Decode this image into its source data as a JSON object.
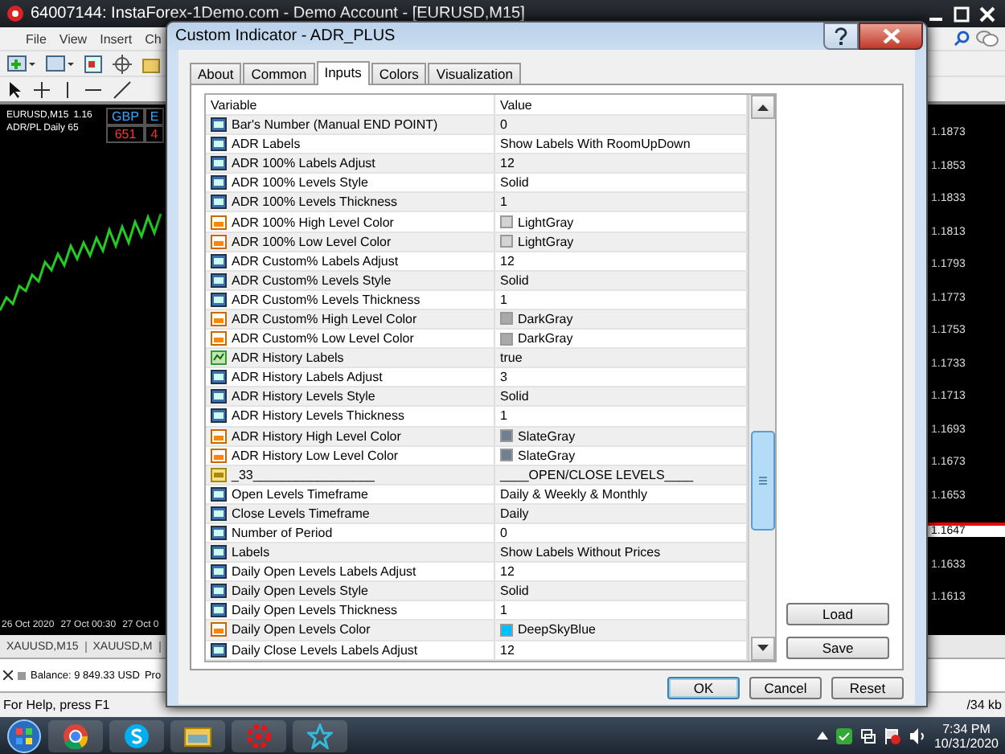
{
  "app": {
    "title": "64007144: InstaForex-1Demo.com - Demo Account - [EURUSD,M15]",
    "menu": [
      "File",
      "View",
      "Insert",
      "Ch"
    ]
  },
  "chart": {
    "symbol": "EURUSD,M15",
    "symbol_price": "1.16",
    "indicator": "ADR/PL Daily 65",
    "panel": [
      {
        "name": "GBP",
        "value": "651"
      },
      {
        "name": "E",
        "value": "4"
      }
    ],
    "price_labels": [
      {
        "label": "1.1873",
        "current": false
      },
      {
        "label": "1.1853",
        "current": false
      },
      {
        "label": "1.1833",
        "current": false
      },
      {
        "label": "1.1813",
        "current": false
      },
      {
        "label": "1.1793",
        "current": false
      },
      {
        "label": "1.1773",
        "current": false
      },
      {
        "label": "1.1753",
        "current": false
      },
      {
        "label": "1.1733",
        "current": false
      },
      {
        "label": "1.1713",
        "current": false
      },
      {
        "label": "1.1693",
        "current": false
      },
      {
        "label": "1.1673",
        "current": false
      },
      {
        "label": "1.1653",
        "current": false
      },
      {
        "label": "1.1647",
        "current": true
      },
      {
        "label": "1.1633",
        "current": false
      },
      {
        "label": "1.1613",
        "current": false
      }
    ],
    "time_labels": [
      "26 Oct 2020",
      "27 Oct 00:30",
      "27 Oct 0"
    ]
  },
  "chart_tabs": [
    {
      "label": "XAUUSD,M15",
      "selected": false
    },
    {
      "label": "XAUUSD,M",
      "selected": false
    }
  ],
  "terminal": {
    "balance": "Balance: 9 849.33 USD",
    "next": "Pro"
  },
  "status_bar": {
    "help": "For Help, press F1",
    "traffic": "/34 kb"
  },
  "dialog": {
    "title": "Custom Indicator - ADR_PLUS",
    "tabs": [
      {
        "label": "About",
        "selected": false
      },
      {
        "label": "Common",
        "selected": false
      },
      {
        "label": "Inputs",
        "selected": true
      },
      {
        "label": "Colors",
        "selected": false
      },
      {
        "label": "Visualization",
        "selected": false
      }
    ],
    "columns": [
      "Variable",
      "Value"
    ],
    "rows": [
      {
        "kind": "int",
        "variable": "Bar's Number (Manual END POINT)",
        "value": "0"
      },
      {
        "kind": "int",
        "variable": "ADR Labels",
        "value": "Show Labels With RoomUpDown"
      },
      {
        "kind": "int",
        "variable": "ADR 100% Labels Adjust",
        "value": "12"
      },
      {
        "kind": "int",
        "variable": "ADR 100% Levels Style",
        "value": "Solid"
      },
      {
        "kind": "int",
        "variable": "ADR 100% Levels Thickness",
        "value": "1"
      },
      {
        "kind": "color",
        "variable": "ADR 100% High Level Color",
        "value": "LightGray",
        "color": "#d3d3d3"
      },
      {
        "kind": "color",
        "variable": "ADR 100% Low Level Color",
        "value": "LightGray",
        "color": "#d3d3d3"
      },
      {
        "kind": "int",
        "variable": "ADR Custom% Labels Adjust",
        "value": "12"
      },
      {
        "kind": "int",
        "variable": "ADR Custom% Levels Style",
        "value": "Solid"
      },
      {
        "kind": "int",
        "variable": "ADR Custom% Levels Thickness",
        "value": "1"
      },
      {
        "kind": "color",
        "variable": "ADR Custom% High Level Color",
        "value": "DarkGray",
        "color": "#a9a9a9"
      },
      {
        "kind": "color",
        "variable": "ADR Custom% Low Level Color",
        "value": "DarkGray",
        "color": "#a9a9a9"
      },
      {
        "kind": "bool",
        "variable": "ADR History Labels",
        "value": "true"
      },
      {
        "kind": "int",
        "variable": "ADR History Labels Adjust",
        "value": "3"
      },
      {
        "kind": "int",
        "variable": "ADR History Levels Style",
        "value": "Solid"
      },
      {
        "kind": "int",
        "variable": "ADR History Levels Thickness",
        "value": "1"
      },
      {
        "kind": "color",
        "variable": "ADR History High Level Color",
        "value": "SlateGray",
        "color": "#708090"
      },
      {
        "kind": "color",
        "variable": "ADR History Low Level Color",
        "value": "SlateGray",
        "color": "#708090"
      },
      {
        "kind": "string",
        "variable": "_33_________________",
        "value": "____OPEN/CLOSE LEVELS____"
      },
      {
        "kind": "int",
        "variable": "Open Levels Timeframe",
        "value": "Daily & Weekly & Monthly"
      },
      {
        "kind": "int",
        "variable": "Close Levels Timeframe",
        "value": "Daily"
      },
      {
        "kind": "int",
        "variable": "Number of Period",
        "value": "0"
      },
      {
        "kind": "int",
        "variable": "Labels",
        "value": "Show Labels Without Prices"
      },
      {
        "kind": "int",
        "variable": "Daily Open Levels Labels Adjust",
        "value": "12"
      },
      {
        "kind": "int",
        "variable": "Daily Open Levels Style",
        "value": "Solid"
      },
      {
        "kind": "int",
        "variable": "Daily Open Levels Thickness",
        "value": "1"
      },
      {
        "kind": "color",
        "variable": "Daily Open Levels Color",
        "value": "DeepSkyBlue",
        "color": "#00bfff"
      },
      {
        "kind": "int",
        "variable": "Daily Close Levels Labels Adjust",
        "value": "12"
      }
    ],
    "side_buttons": [
      "Load",
      "Save"
    ],
    "buttons": [
      {
        "label": "OK",
        "default": true
      },
      {
        "label": "Cancel",
        "default": false
      },
      {
        "label": "Reset",
        "default": false
      }
    ]
  },
  "taskbar": {
    "time": "7:34 PM",
    "date": "10/31/2020"
  }
}
